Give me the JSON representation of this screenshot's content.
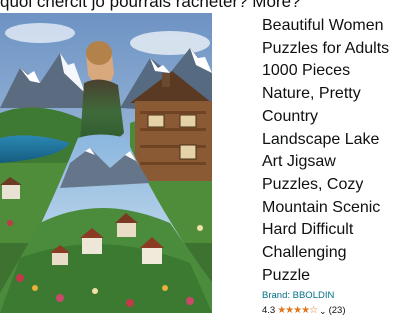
{
  "header_fragment": "quoi chercit jo pourrais racheter? More?",
  "product": {
    "title": "Beautiful Women Puzzles for Adults 1000 Pieces Nature, Pretty Country Landscape Lake Art Jigsaw Puzzles, Cozy Mountain Scenic Hard Difficult Challenging Puzzle",
    "brand": "Brand: BBOLDIN",
    "rating_value": "4.3",
    "rating_stars": "★★★★☆",
    "review_count": "(23)"
  },
  "colors": {
    "link": "#007185",
    "star": "#de7921",
    "text": "#0f1111"
  }
}
